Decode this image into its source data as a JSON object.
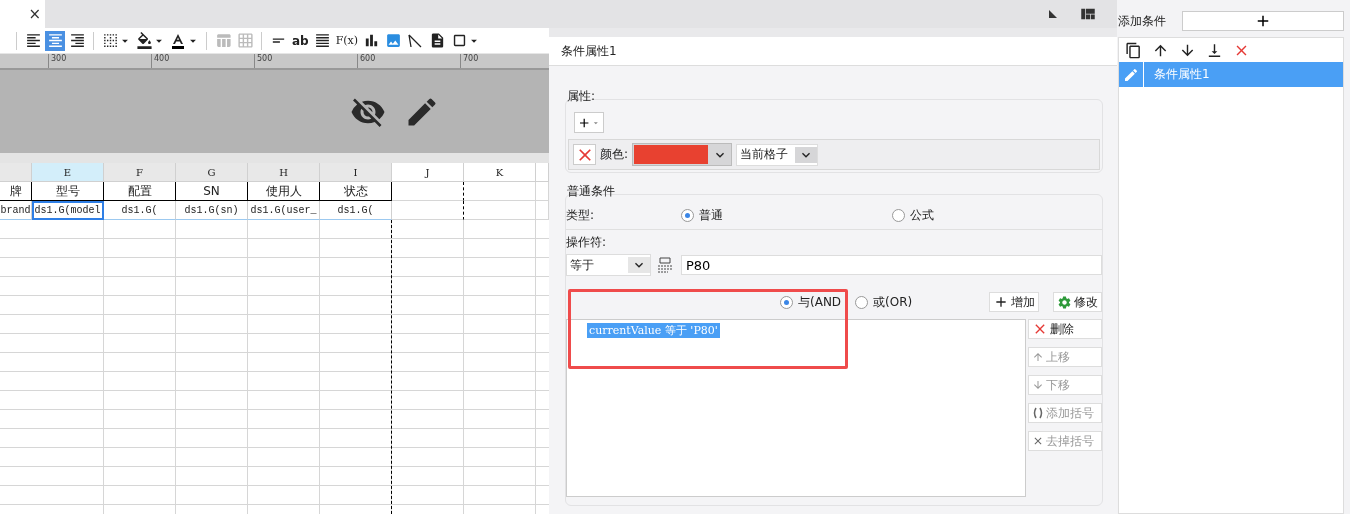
{
  "tab": {
    "close": "×"
  },
  "toolbar": {
    "alignment": [
      {
        "kind": "left",
        "selected": false
      },
      {
        "kind": "center",
        "selected": true
      },
      {
        "kind": "right",
        "selected": false
      }
    ],
    "text_tool": "ab",
    "formula_tool": "F(x)"
  },
  "ruler": {
    "ticks": [
      "300",
      "400",
      "500",
      "600",
      "700"
    ]
  },
  "sheet": {
    "columns": [
      {
        "selected": false
      },
      {
        "label": "E",
        "selected": true
      },
      {
        "label": "F",
        "selected": false
      },
      {
        "label": "G",
        "selected": false
      },
      {
        "label": "H",
        "selected": false
      },
      {
        "label": "I",
        "selected": false
      },
      {
        "label": "J",
        "selected": false
      },
      {
        "label": "K",
        "selected": false
      }
    ],
    "rows": [
      {
        "cells": [
          {
            "text": "牌",
            "selected": false
          },
          {
            "text": "型号",
            "selected": false
          },
          {
            "text": "配置",
            "selected": false
          },
          {
            "text": "SN",
            "selected": false
          },
          {
            "text": "使用人",
            "selected": false
          },
          {
            "text": "状态",
            "selected": false
          }
        ]
      },
      {
        "cells": [
          {
            "text": "brand",
            "selected": false
          },
          {
            "text": "ds1.G(model",
            "selected": true
          },
          {
            "text": "ds1.G(",
            "selected": false
          },
          {
            "text": "ds1.G(sn)",
            "selected": false
          },
          {
            "text": "ds1.G(user_",
            "selected": false
          },
          {
            "text": "ds1.G(",
            "selected": false
          }
        ]
      }
    ]
  },
  "dialog": {
    "title": "条件属性1",
    "attributes": {
      "legend": "属性:",
      "color_label": "颜色:",
      "color": "#e84130",
      "scope": "当前格子"
    },
    "normal": {
      "legend": "普通条件",
      "type_label": "类型:",
      "types": [
        {
          "label": "普通",
          "selected": true
        },
        {
          "label": "公式",
          "selected": false
        }
      ],
      "operator_label": "操作符:",
      "operator": "等于",
      "value": "P80",
      "joins": [
        {
          "label": "与(AND",
          "selected": true
        },
        {
          "label": "或(OR)",
          "selected": false
        }
      ],
      "buttons": [
        {
          "kind": "add",
          "label": "增加",
          "disabled": false
        },
        {
          "kind": "edit",
          "label": "修改",
          "disabled": false
        }
      ],
      "conditions": [
        {
          "text": "currentValue 等于 'P80'",
          "selected": true
        }
      ],
      "side_buttons": [
        {
          "kind": "delete",
          "label": "删除",
          "disabled": false
        },
        {
          "kind": "up",
          "label": "上移",
          "disabled": true
        },
        {
          "kind": "down",
          "label": "下移",
          "disabled": true
        },
        {
          "kind": "add-bracket",
          "label": "添加括号",
          "disabled": true
        },
        {
          "kind": "remove-bracket",
          "label": "去掉括号",
          "disabled": true
        }
      ]
    }
  },
  "panel": {
    "title": "添加条件",
    "items": [
      {
        "label": "条件属性1",
        "selected": true
      }
    ]
  }
}
